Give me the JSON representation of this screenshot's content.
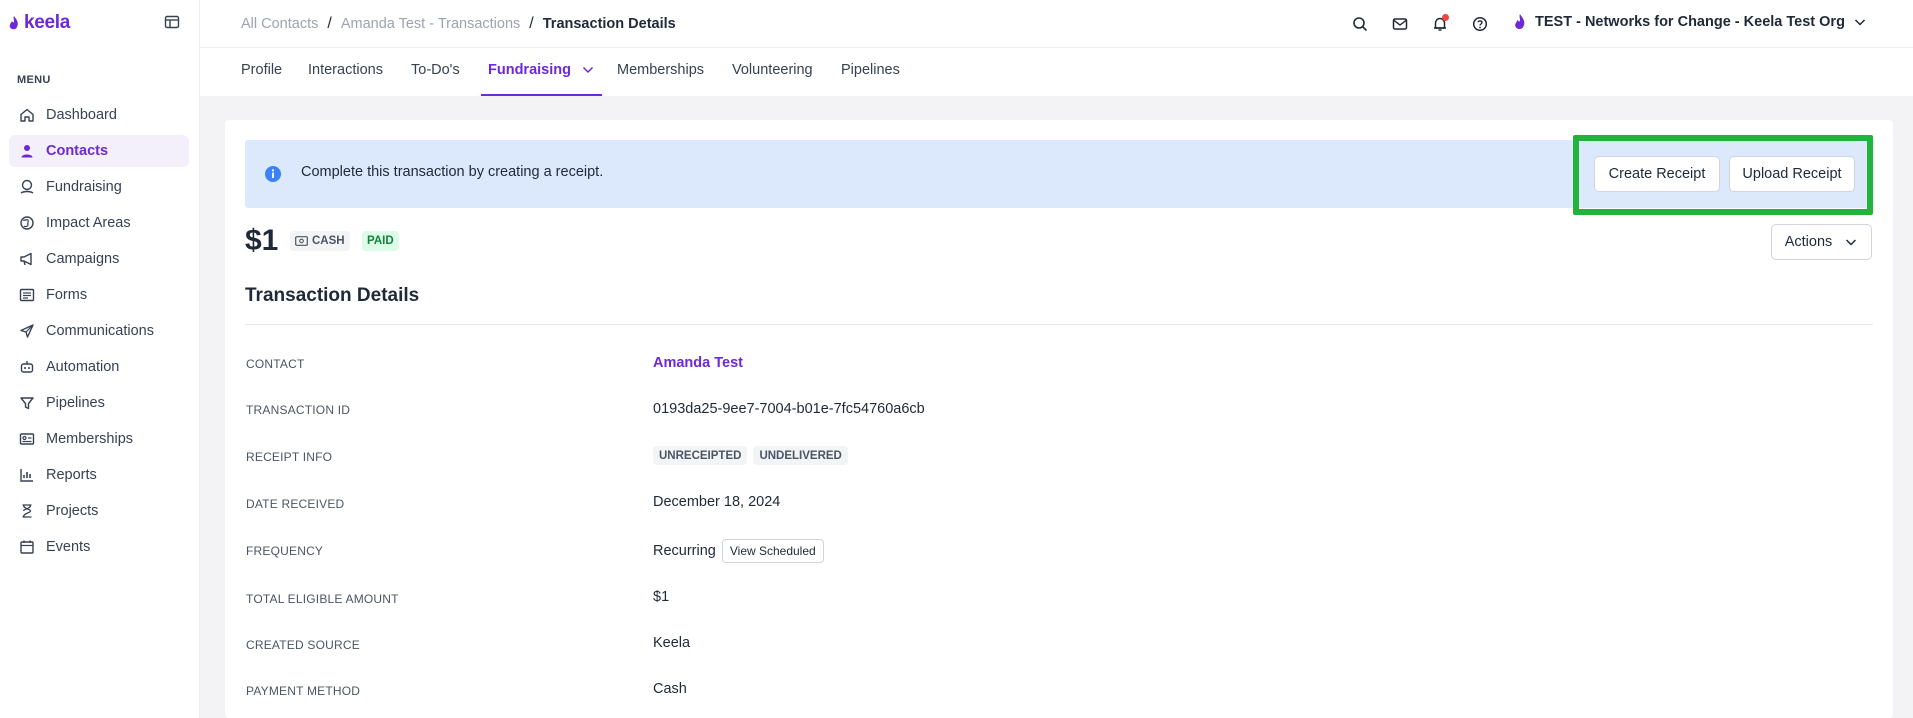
{
  "app": {
    "logo_text": "keela"
  },
  "sidebar": {
    "menu_label": "MENU",
    "items": [
      {
        "label": "Dashboard",
        "icon": "home-icon",
        "active": false
      },
      {
        "label": "Contacts",
        "icon": "person-icon",
        "active": true
      },
      {
        "label": "Fundraising",
        "icon": "donation-icon",
        "active": false
      },
      {
        "label": "Impact Areas",
        "icon": "globe-icon",
        "active": false
      },
      {
        "label": "Campaigns",
        "icon": "megaphone-icon",
        "active": false
      },
      {
        "label": "Forms",
        "icon": "form-icon",
        "active": false
      },
      {
        "label": "Communications",
        "icon": "send-icon",
        "active": false
      },
      {
        "label": "Automation",
        "icon": "robot-icon",
        "active": false
      },
      {
        "label": "Pipelines",
        "icon": "funnel-icon",
        "active": false
      },
      {
        "label": "Memberships",
        "icon": "id-card-icon",
        "active": false
      },
      {
        "label": "Reports",
        "icon": "chart-icon",
        "active": false
      },
      {
        "label": "Projects",
        "icon": "hourglass-icon",
        "active": false
      },
      {
        "label": "Events",
        "icon": "calendar-icon",
        "active": false
      }
    ]
  },
  "breadcrumb": {
    "items": [
      "All Contacts",
      "Amanda Test - Transactions",
      "Transaction Details"
    ],
    "separator": "/"
  },
  "header": {
    "org_name": "TEST - Networks for Change - Keela Test Org",
    "icons": [
      "search-icon",
      "mail-icon",
      "bell-icon",
      "help-icon"
    ]
  },
  "tabs": [
    {
      "label": "Profile"
    },
    {
      "label": "Interactions"
    },
    {
      "label": "To-Do's"
    },
    {
      "label": "Fundraising",
      "active": true
    },
    {
      "label": "Memberships"
    },
    {
      "label": "Volunteering"
    },
    {
      "label": "Pipelines"
    }
  ],
  "alert": {
    "text": "Complete this transaction by creating a receipt.",
    "create_label": "Create Receipt",
    "upload_label": "Upload Receipt"
  },
  "transaction": {
    "amount": "$1",
    "method_badge": "CASH",
    "status_badge": "PAID",
    "actions_label": "Actions",
    "section_title": "Transaction Details"
  },
  "details": {
    "contact_label": "CONTACT",
    "contact_value": "Amanda Test",
    "transaction_id_label": "TRANSACTION ID",
    "transaction_id_value": "0193da25-9ee7-7004-b01e-7fc54760a6cb",
    "receipt_info_label": "RECEIPT INFO",
    "receipt_tags": [
      "UNRECEIPTED",
      "UNDELIVERED"
    ],
    "date_received_label": "DATE RECEIVED",
    "date_received_value": "December 18, 2024",
    "frequency_label": "FREQUENCY",
    "frequency_value": "Recurring",
    "view_scheduled_label": "View Scheduled",
    "total_eligible_label": "TOTAL ELIGIBLE AMOUNT",
    "total_eligible_value": "$1",
    "created_source_label": "CREATED SOURCE",
    "created_source_value": "Keela",
    "payment_method_label": "PAYMENT METHOD",
    "payment_method_value": "Cash"
  },
  "colors": {
    "brand": "#6d28d9",
    "alert_bg": "#dce9fd",
    "highlight": "#22b33c",
    "paid_bg": "#dcfce7"
  }
}
